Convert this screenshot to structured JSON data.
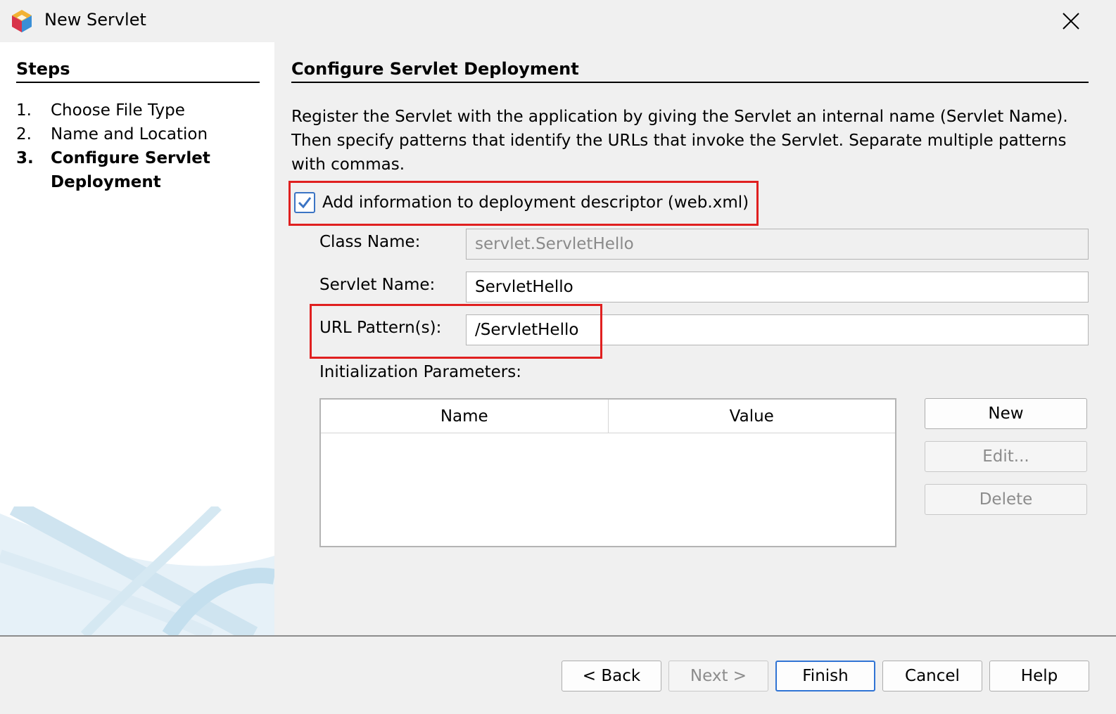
{
  "window": {
    "title": "New Servlet",
    "logo_icon": "netbeans-cube-logo",
    "close_icon": "close-icon"
  },
  "steps": {
    "heading": "Steps",
    "items": [
      {
        "num": "1.",
        "label": "Choose File Type",
        "current": false
      },
      {
        "num": "2.",
        "label": "Name and Location",
        "current": false
      },
      {
        "num": "3.",
        "label": "Configure Servlet Deployment",
        "current": true
      }
    ]
  },
  "content": {
    "heading": "Configure Servlet Deployment",
    "description": "Register the Servlet with the application by giving the Servlet an internal name (Servlet Name). Then specify patterns that identify the URLs that invoke the Servlet. Separate multiple patterns with commas.",
    "add_info_checkbox": {
      "label": "Add information to deployment descriptor (web.xml)",
      "checked": true
    },
    "class_name": {
      "label": "Class Name:",
      "value": "servlet.ServletHello",
      "enabled": false
    },
    "servlet_name": {
      "label": "Servlet Name:",
      "value": "ServletHello"
    },
    "url_pattern": {
      "label": "URL Pattern(s):",
      "value": "/ServletHello"
    },
    "init_params": {
      "label": "Initialization Parameters:",
      "columns": [
        "Name",
        "Value"
      ],
      "rows": []
    },
    "side_buttons": {
      "new": "New",
      "edit": "Edit...",
      "delete": "Delete"
    }
  },
  "footer": {
    "back": "< Back",
    "next": "Next >",
    "finish": "Finish",
    "cancel": "Cancel",
    "help": "Help"
  },
  "colors": {
    "highlight": "#e02020",
    "checkbox_accent": "#3b74c4",
    "default_button_border": "#3074d4"
  }
}
